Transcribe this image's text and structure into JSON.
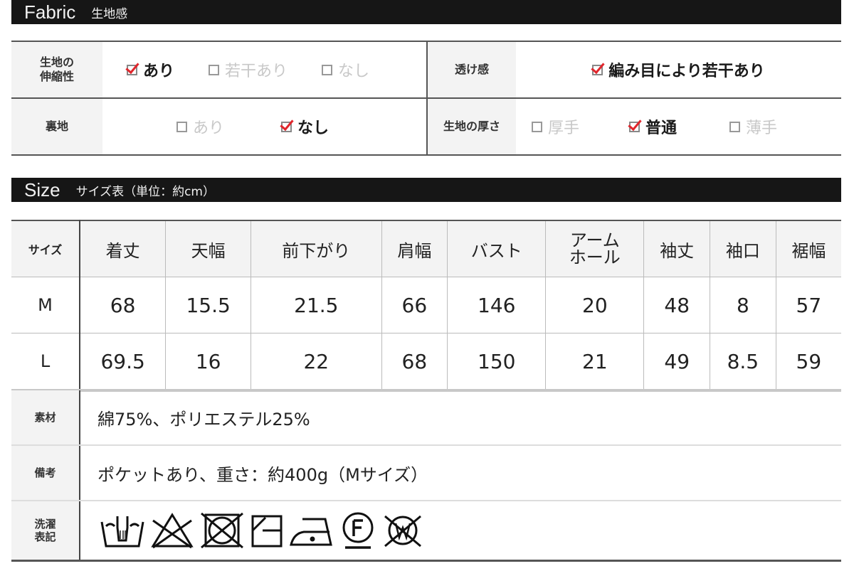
{
  "fabric_header": {
    "en": "Fabric",
    "jp": "生地感"
  },
  "fabric": {
    "stretch": {
      "label": "生地の\n伸縮性",
      "options": [
        {
          "label": "あり",
          "checked": true
        },
        {
          "label": "若干あり",
          "checked": false
        },
        {
          "label": "なし",
          "checked": false
        }
      ]
    },
    "sheerness": {
      "label": "透け感",
      "options": [
        {
          "label": "編み目により若干あり",
          "checked": true
        }
      ]
    },
    "lining": {
      "label": "裏地",
      "options": [
        {
          "label": "あり",
          "checked": false
        },
        {
          "label": "なし",
          "checked": true
        }
      ]
    },
    "thickness": {
      "label": "生地の厚さ",
      "options": [
        {
          "label": "厚手",
          "checked": false
        },
        {
          "label": "普通",
          "checked": true
        },
        {
          "label": "薄手",
          "checked": false
        }
      ]
    }
  },
  "size_header": {
    "en": "Size",
    "jp": "サイズ表（単位：約cm）"
  },
  "size_table": {
    "corner": "サイズ",
    "columns": [
      "着丈",
      "天幅",
      "前下がり",
      "肩幅",
      "バスト",
      "アーム\nホール",
      "袖丈",
      "袖口",
      "裾幅"
    ],
    "rows": [
      {
        "size": "M",
        "values": [
          "68",
          "15.5",
          "21.5",
          "66",
          "146",
          "20",
          "48",
          "8",
          "57"
        ]
      },
      {
        "size": "L",
        "values": [
          "69.5",
          "16",
          "22",
          "68",
          "150",
          "21",
          "49",
          "8.5",
          "59"
        ]
      }
    ]
  },
  "info": {
    "material": {
      "label": "素材",
      "value": "綿75%、ポリエステル25%"
    },
    "notes": {
      "label": "備考",
      "value": "ポケットあり、重さ：約400g（Mサイズ）"
    },
    "care": {
      "label": "洗濯\n表記",
      "icons": [
        "hand-wash",
        "no-bleach",
        "no-tumble-dry",
        "line-dry-shade",
        "iron-low",
        "dry-clean-f",
        "no-wet-clean"
      ]
    }
  },
  "colors": {
    "header_bg": "#161616",
    "check": "#e0262c",
    "label_bg": "#f3f3f3"
  }
}
